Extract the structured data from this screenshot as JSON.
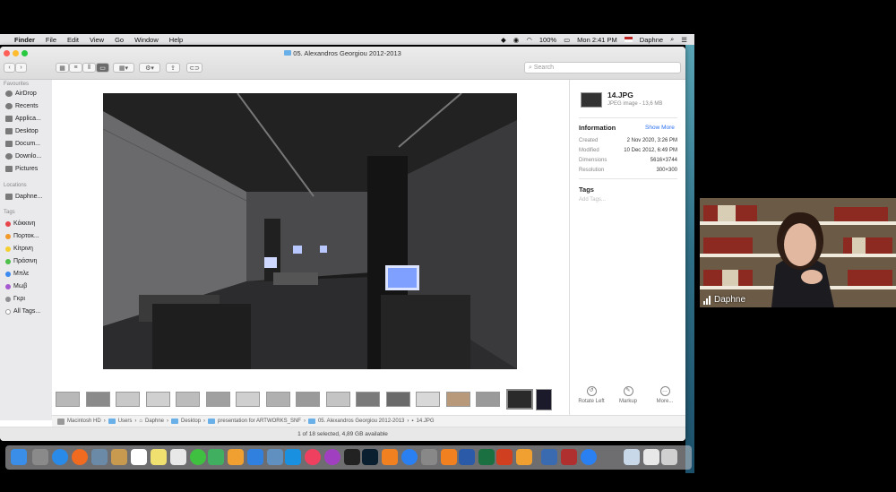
{
  "menubar": {
    "app": "Finder",
    "items": [
      "File",
      "Edit",
      "View",
      "Go",
      "Window",
      "Help"
    ],
    "battery": "100%",
    "clock": "Mon 2:41 PM",
    "user": "Daphne"
  },
  "window": {
    "title": "05. Alexandros Georgiou 2012-2013",
    "search_placeholder": "Search"
  },
  "sidebar": {
    "favourites_header": "Favourites",
    "favourites": [
      "AirDrop",
      "Recents",
      "Applica...",
      "Desktop",
      "Docum...",
      "Downlo...",
      "Pictures"
    ],
    "locations_header": "Locations",
    "locations": [
      "Daphne..."
    ],
    "tags_header": "Tags",
    "tags": [
      {
        "label": "Κόκκινη",
        "color": "#e8454a"
      },
      {
        "label": "Πορτοκ...",
        "color": "#f39a2b"
      },
      {
        "label": "Κίτρινη",
        "color": "#f5cf2f"
      },
      {
        "label": "Πράσινη",
        "color": "#4cc04a"
      },
      {
        "label": "Μπλε",
        "color": "#3c8bf0"
      },
      {
        "label": "Μωβ",
        "color": "#a65ad1"
      },
      {
        "label": "Γκρι",
        "color": "#8e8e93"
      },
      {
        "label": "All Tags...",
        "color": "#bdbdbd"
      }
    ]
  },
  "inspector": {
    "filename": "14.JPG",
    "filetype": "JPEG image - 13,6 MB",
    "info_header": "Information",
    "show_more": "Show More",
    "rows": [
      {
        "key": "Created",
        "value": "2 Nov 2020, 3:26 PM"
      },
      {
        "key": "Modified",
        "value": "10 Dec 2012, 6:49 PM"
      },
      {
        "key": "Dimensions",
        "value": "5616×3744"
      },
      {
        "key": "Resolution",
        "value": "300×300"
      }
    ],
    "tags_header": "Tags",
    "add_tags": "Add Tags...",
    "actions": [
      "Rotate Left",
      "Markup",
      "More..."
    ]
  },
  "pathbar": [
    "Macintosh HD",
    "Users",
    "Daphne",
    "Desktop",
    "presentation for ARTWORKS_SNF",
    "05. Alexandros Georgiou 2012-2013",
    "14.JPG"
  ],
  "status": "1 of 18 selected, 4,89 GB available",
  "video": {
    "participant": "Daphne"
  }
}
